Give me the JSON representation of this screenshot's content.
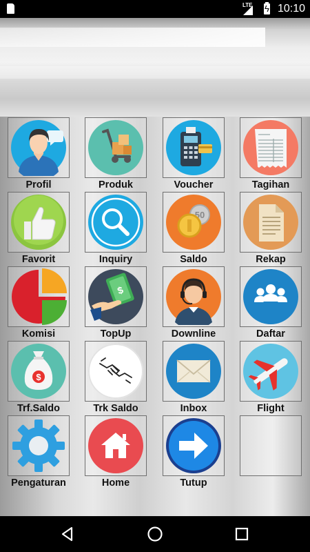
{
  "status_bar": {
    "network": "LTE",
    "time": "10:10"
  },
  "menu": {
    "items": [
      {
        "label": "Profil",
        "icon": "profile-icon"
      },
      {
        "label": "Produk",
        "icon": "cart-icon"
      },
      {
        "label": "Voucher",
        "icon": "payment-terminal-icon"
      },
      {
        "label": "Tagihan",
        "icon": "invoice-icon"
      },
      {
        "label": "Favorit",
        "icon": "thumbs-up-icon"
      },
      {
        "label": "Inquiry",
        "icon": "search-icon"
      },
      {
        "label": "Saldo",
        "icon": "coins-icon"
      },
      {
        "label": "Rekap",
        "icon": "document-icon"
      },
      {
        "label": "Komisi",
        "icon": "pie-chart-icon"
      },
      {
        "label": "TopUp",
        "icon": "cash-hand-icon"
      },
      {
        "label": "Downline",
        "icon": "headset-agent-icon"
      },
      {
        "label": "Daftar",
        "icon": "group-icon"
      },
      {
        "label": "Trf.Saldo",
        "icon": "money-bag-icon"
      },
      {
        "label": "Trk Saldo",
        "icon": "handshake-icon"
      },
      {
        "label": "Inbox",
        "icon": "envelope-icon"
      },
      {
        "label": "Flight",
        "icon": "airplane-icon"
      },
      {
        "label": "Pengaturan",
        "icon": "gear-icon"
      },
      {
        "label": "Home",
        "icon": "home-icon"
      },
      {
        "label": "Tutup",
        "icon": "arrow-right-icon"
      }
    ]
  },
  "colors": {
    "teal": "#5bbfae",
    "salmon": "#f47a64",
    "blue": "#1ea9e1",
    "orange": "#ef7b2c",
    "green": "#8bc53f"
  }
}
